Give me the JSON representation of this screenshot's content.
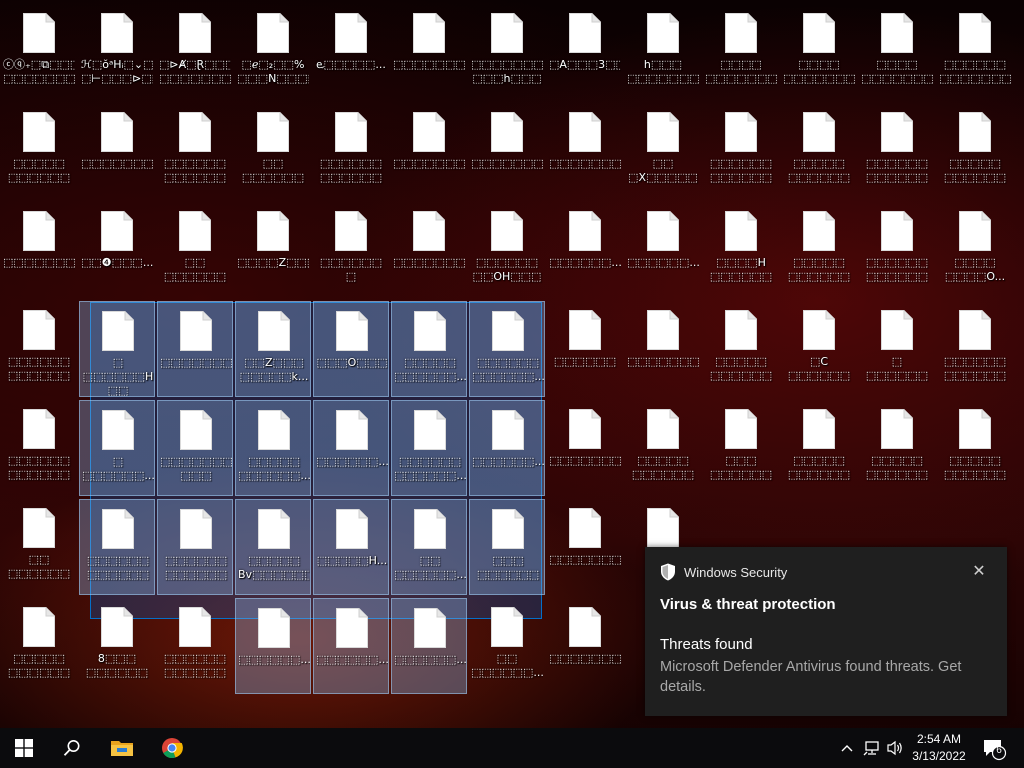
{
  "desktop": {
    "selection_active": true,
    "icons": [
      {
        "label": "ⓒⓠ₊⬚⧉⬚⬚⬚\n⬚⬚⬚⬚⬚⬚⬚⬚",
        "selected": false
      },
      {
        "label": "ℋ⬚ŏᵃHᵢ⬚⌄⬚\n⬚⊢⬚⬚⬚⊳⬚⬚",
        "selected": false
      },
      {
        "label": "⬚⊳Ⱥ⬚Ɽ⬚⬚⬚\n⬚⬚⬚⬚⬚⬚⬚⬚",
        "selected": false
      },
      {
        "label": "⬚ℯ⬚₂⬚⬚%\n⬚⬚⬚N⬚⬚⬚⬚",
        "selected": false
      },
      {
        "label": "ⱸ⬚⬚⬚⬚⬚...",
        "selected": false
      },
      {
        "label": "⬚⬚⬚⬚⬚⬚⬚...",
        "selected": false
      },
      {
        "label": "⬚⬚⬚⬚⬚⬚⬚\n⬚⬚⬚h⬚⬚⬚",
        "selected": false
      },
      {
        "label": "⬚A⬚⬚⬚3⬚⬚",
        "selected": false
      },
      {
        "label": "h⬚⬚⬚\n⬚⬚⬚⬚⬚⬚⬚",
        "selected": false
      },
      {
        "label": "⬚⬚⬚⬚\n⬚⬚⬚⬚⬚⬚⬚",
        "selected": false
      },
      {
        "label": "⬚⬚⬚⬚\n⬚⬚⬚⬚⬚⬚⬚",
        "selected": false
      },
      {
        "label": "⬚⬚⬚⬚\n⬚⬚⬚⬚⬚⬚⬚",
        "selected": false
      },
      {
        "label": "⬚⬚⬚⬚⬚⬚\n⬚⬚⬚⬚⬚⬚⬚",
        "selected": false
      },
      {
        "label": "⬚⬚⬚⬚⬚\n⬚⬚⬚⬚⬚⬚",
        "selected": false
      },
      {
        "label": "⬚⬚⬚⬚⬚⬚⬚",
        "selected": false
      },
      {
        "label": "⬚⬚⬚⬚⬚⬚\n⬚⬚⬚⬚⬚⬚",
        "selected": false
      },
      {
        "label": "⬚⬚\n⬚⬚⬚⬚⬚⬚",
        "selected": false
      },
      {
        "label": "⬚⬚⬚⬚⬚⬚\n⬚⬚⬚⬚⬚⬚",
        "selected": false
      },
      {
        "label": "⬚⬚⬚⬚⬚⬚⬚",
        "selected": false
      },
      {
        "label": "⬚⬚⬚⬚⬚⬚⬚",
        "selected": false
      },
      {
        "label": "⬚⬚⬚⬚⬚⬚⬚⬚",
        "selected": false
      },
      {
        "label": "⬚⬚\n⬚X⬚⬚⬚⬚⬚",
        "selected": false
      },
      {
        "label": "⬚⬚⬚⬚⬚⬚\n⬚⬚⬚⬚⬚⬚",
        "selected": false
      },
      {
        "label": "⬚⬚⬚⬚⬚\n⬚⬚⬚⬚⬚⬚",
        "selected": false
      },
      {
        "label": "⬚⬚⬚⬚⬚⬚\n⬚⬚⬚⬚⬚⬚",
        "selected": false
      },
      {
        "label": "⬚⬚⬚⬚⬚\n⬚⬚⬚⬚⬚⬚",
        "selected": false
      },
      {
        "label": "⬚⬚⬚⬚⬚⬚⬚...",
        "selected": false
      },
      {
        "label": "⬚⬚❹⬚⬚⬚...",
        "selected": false
      },
      {
        "label": "⬚⬚\n⬚⬚⬚⬚⬚⬚",
        "selected": false
      },
      {
        "label": "⬚⬚⬚⬚Z⬚⬚⬚...",
        "selected": false
      },
      {
        "label": "⬚⬚⬚⬚⬚⬚\n⬚",
        "selected": false
      },
      {
        "label": "⬚⬚⬚⬚⬚⬚⬚...",
        "selected": false
      },
      {
        "label": "⬚⬚⬚⬚⬚⬚\n⬚⬚OH⬚⬚⬚",
        "selected": false
      },
      {
        "label": "⬚⬚⬚⬚⬚⬚...",
        "selected": false
      },
      {
        "label": "⬚⬚⬚⬚⬚⬚...",
        "selected": false
      },
      {
        "label": "⬚⬚⬚⬚H\n⬚⬚⬚⬚⬚⬚",
        "selected": false
      },
      {
        "label": "⬚⬚⬚⬚⬚\n⬚⬚⬚⬚⬚⬚",
        "selected": false
      },
      {
        "label": "⬚⬚⬚⬚⬚⬚\n⬚⬚⬚⬚⬚⬚",
        "selected": false
      },
      {
        "label": "⬚⬚⬚⬚\n⬚⬚⬚⬚O...",
        "selected": false
      },
      {
        "label": "⬚⬚⬚⬚⬚⬚\n⬚⬚⬚⬚⬚⬚",
        "selected": false
      },
      {
        "label": "⬚\n⬚⬚⬚⬚⬚⬚H\n⬚⬚",
        "selected": true
      },
      {
        "label": "⬚⬚⬚⬚⬚⬚⬚...",
        "selected": true
      },
      {
        "label": "⬚⬚Z⬚⬚⬚\n⬚⬚⬚⬚⬚k...",
        "selected": true
      },
      {
        "label": "⬚⬚⬚O⬚⬚⬚",
        "selected": true
      },
      {
        "label": "⬚⬚⬚⬚⬚\n⬚⬚⬚⬚⬚⬚...",
        "selected": true
      },
      {
        "label": "⬚⬚⬚⬚⬚⬚\n⬚⬚⬚⬚⬚⬚...",
        "selected": true
      },
      {
        "label": "⬚⬚⬚⬚⬚⬚",
        "selected": false
      },
      {
        "label": "⬚⬚⬚⬚⬚⬚⬚",
        "selected": false
      },
      {
        "label": "⬚⬚⬚⬚⬚\n⬚⬚⬚⬚⬚⬚",
        "selected": false
      },
      {
        "label": "⬚C\n⬚⬚⬚⬚⬚⬚",
        "selected": false
      },
      {
        "label": "⬚\n⬚⬚⬚⬚⬚⬚",
        "selected": false
      },
      {
        "label": "⬚⬚⬚⬚⬚⬚\n⬚⬚⬚⬚⬚⬚",
        "selected": false
      },
      {
        "label": "⬚⬚⬚⬚⬚⬚\n⬚⬚⬚⬚⬚⬚",
        "selected": false
      },
      {
        "label": "⬚\n⬚⬚⬚⬚⬚⬚...",
        "selected": true
      },
      {
        "label": "⬚⬚⬚⬚⬚⬚⬚\n⬚⬚⬚",
        "selected": true
      },
      {
        "label": "⬚⬚⬚⬚⬚\n⬚⬚⬚⬚⬚⬚...",
        "selected": true
      },
      {
        "label": "⬚⬚⬚⬚⬚⬚...",
        "selected": true
      },
      {
        "label": "⬚⬚⬚⬚⬚⬚\n⬚⬚⬚⬚⬚⬚...",
        "selected": true
      },
      {
        "label": "⬚⬚⬚⬚⬚⬚...",
        "selected": true
      },
      {
        "label": "⬚⬚⬚⬚⬚⬚⬚",
        "selected": false
      },
      {
        "label": "⬚⬚⬚⬚⬚\n⬚⬚⬚⬚⬚⬚",
        "selected": false
      },
      {
        "label": "⬚⬚⬚\n⬚⬚⬚⬚⬚⬚",
        "selected": false
      },
      {
        "label": "⬚⬚⬚⬚⬚\n⬚⬚⬚⬚⬚⬚",
        "selected": false
      },
      {
        "label": "⬚⬚⬚⬚⬚\n⬚⬚⬚⬚⬚⬚",
        "selected": false
      },
      {
        "label": "⬚⬚⬚⬚⬚\n⬚⬚⬚⬚⬚⬚",
        "selected": false
      },
      {
        "label": "⬚⬚\n⬚⬚⬚⬚⬚⬚",
        "selected": false
      },
      {
        "label": "⬚⬚⬚⬚⬚⬚\n⬚⬚⬚⬚⬚⬚",
        "selected": true
      },
      {
        "label": "⬚⬚⬚⬚⬚⬚\n⬚⬚⬚⬚⬚⬚",
        "selected": true
      },
      {
        "label": "⬚⬚⬚⬚⬚\nBv⬚⬚⬚⬚⬚⬚",
        "selected": true
      },
      {
        "label": "⬚⬚⬚⬚⬚H...",
        "selected": true
      },
      {
        "label": "⬚⬚\n⬚⬚⬚⬚⬚⬚...",
        "selected": true
      },
      {
        "label": "⬚⬚⬚\n⬚⬚⬚⬚⬚⬚",
        "selected": true
      },
      {
        "label": "⬚⬚⬚⬚⬚⬚⬚",
        "selected": false
      },
      {
        "label": "⬚",
        "selected": false
      },
      {
        "label": "⬚⬚⬚⬚⬚\n⬚⬚⬚⬚⬚⬚",
        "selected": false
      },
      {
        "label": "8⬚⬚⬚\n⬚⬚⬚⬚⬚⬚",
        "selected": false
      },
      {
        "label": "⬚⬚⬚⬚⬚⬚\n⬚⬚⬚⬚⬚⬚",
        "selected": false
      },
      {
        "label": "⬚⬚⬚⬚⬚⬚...",
        "selected": true
      },
      {
        "label": "⬚⬚⬚⬚⬚⬚...",
        "selected": true
      },
      {
        "label": "⬚⬚⬚⬚⬚⬚...",
        "selected": true
      },
      {
        "label": "⬚⬚\n⬚⬚⬚⬚⬚⬚...",
        "selected": false
      },
      {
        "label": "⬚⬚⬚⬚⬚⬚⬚",
        "selected": false
      },
      {
        "label": "⬚⬚\n⬚⬚",
        "selected": false
      }
    ]
  },
  "toast": {
    "app_name": "Windows Security",
    "title": "Virus & threat protection",
    "subtitle": "Threats found",
    "body": "Microsoft Defender Antivirus found threats. Get details.",
    "close_glyph": "✕",
    "shield_icon": "shield-icon"
  },
  "taskbar": {
    "time": "2:54 AM",
    "date": "3/13/2022",
    "notification_count": "6",
    "tray_chevron": "^",
    "pinned": [
      "start-icon",
      "search-icon",
      "file-explorer-icon",
      "chrome-icon"
    ]
  },
  "colors": {
    "toast_bg": "#1f1f1f",
    "taskbar_bg": "#0b0b0d",
    "selection": "#0078d7"
  }
}
